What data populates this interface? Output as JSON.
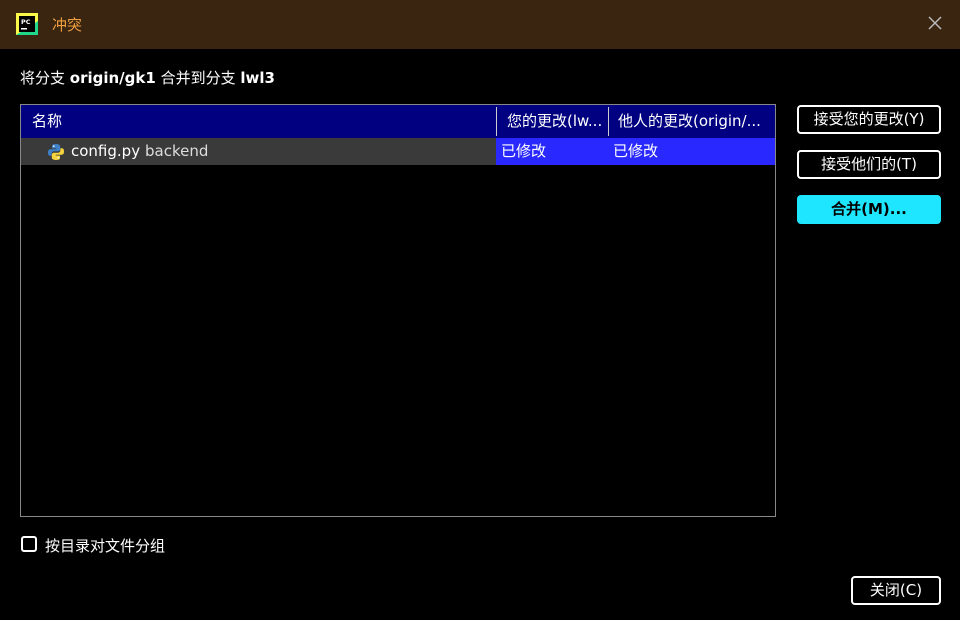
{
  "window": {
    "title": "冲突",
    "app_icon": "pycharm-icon",
    "close_icon": "close-icon",
    "title_color": "#f0a040",
    "titlebar_bg": "#3a2510"
  },
  "merge_description": {
    "prefix": "将分支 ",
    "source_branch": "origin/gk1",
    "middle": " 合并到分支 ",
    "target_branch": "lwl3"
  },
  "table": {
    "columns": [
      "名称",
      "您的更改(lw...",
      "他人的更改(origin/..."
    ],
    "rows": [
      {
        "file_icon": "python-icon",
        "file_name": "config.py",
        "directory": "backend",
        "yours": "已修改",
        "theirs": "已修改"
      }
    ],
    "header_bg": "#000080",
    "selection_bg": "#2929ff"
  },
  "buttons": {
    "accept_yours": "接受您的更改(Y)",
    "accept_theirs": "接受他们的(T)",
    "merge": "合并(M)...",
    "close": "关闭(C)",
    "accent": "#1fe6ff"
  },
  "options": {
    "group_by_directory": "按目录对文件分组",
    "group_by_directory_checked": false
  }
}
